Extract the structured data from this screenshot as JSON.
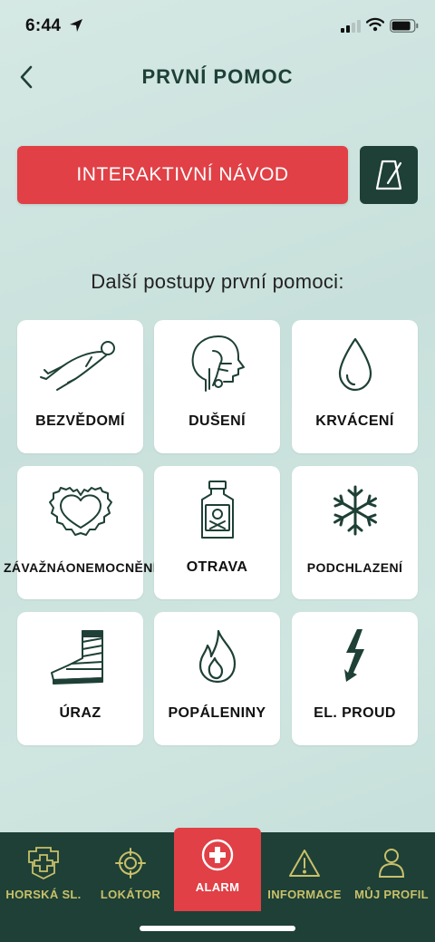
{
  "status_bar": {
    "time": "6:44"
  },
  "header": {
    "title": "PRVNÍ POMOC"
  },
  "actions": {
    "interactive_guide_label": "INTERAKTIVNÍ NÁVOD"
  },
  "subtitle": "Další postupy první pomoci:",
  "tiles": [
    {
      "label": "BEZVĚDOMÍ",
      "icon": "unconscious-person-icon"
    },
    {
      "label": "DUŠENÍ",
      "icon": "choking-head-icon"
    },
    {
      "label": "KRVÁCENÍ",
      "icon": "blood-drop-icon"
    },
    {
      "label_line1": "ZÁVAŽNÁ",
      "label_line2": "ONEMOCNĚNÍ",
      "icon": "heart-illness-icon"
    },
    {
      "label": "OTRAVA",
      "icon": "poison-bottle-icon"
    },
    {
      "label": "PODCHLAZENÍ",
      "icon": "snowflake-icon"
    },
    {
      "label": "ÚRAZ",
      "icon": "bandaged-leg-icon"
    },
    {
      "label": "POPÁLENINY",
      "icon": "flame-icon"
    },
    {
      "label": "EL. PROUD",
      "icon": "lightning-icon"
    }
  ],
  "tabbar": {
    "items": [
      {
        "label": "HORSKÁ SL.",
        "icon": "mountain-rescue-badge-icon"
      },
      {
        "label": "LOKÁTOR",
        "icon": "crosshair-icon"
      },
      {
        "label": "ALARM",
        "icon": "medical-cross-icon",
        "active": true
      },
      {
        "label": "INFORMACE",
        "icon": "warning-triangle-icon"
      },
      {
        "label": "MŮJ PROFIL",
        "icon": "person-icon"
      }
    ]
  },
  "colors": {
    "accent_red": "#e04046",
    "dark_green": "#1e4036",
    "tab_gold": "#c8c06a"
  }
}
